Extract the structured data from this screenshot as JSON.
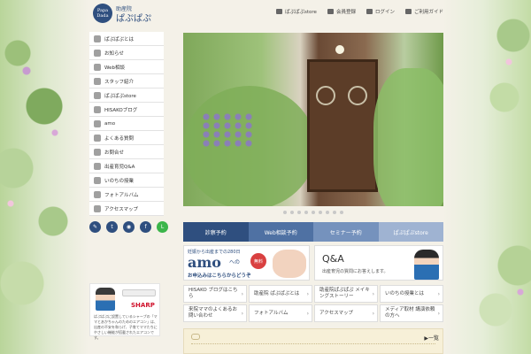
{
  "header": {
    "logo_mark": "Papa Dada",
    "logo_sub": "助産院",
    "logo_name": "ぱぷぱぷ",
    "nav": [
      {
        "label": "ぱぷぱぷstore",
        "icon": "store-icon"
      },
      {
        "label": "会員登録",
        "icon": "user-icon"
      },
      {
        "label": "ログイン",
        "icon": "login-icon"
      },
      {
        "label": "ご利用ガイド",
        "icon": "question-icon"
      }
    ]
  },
  "sidebar": {
    "items": [
      {
        "label": "ぱぷぱぷとは",
        "icon": "info-icon"
      },
      {
        "label": "お知らせ",
        "icon": "news-icon"
      },
      {
        "label": "Web相談",
        "icon": "computer-icon"
      },
      {
        "label": "スタッフ紹介",
        "icon": "staff-icon"
      },
      {
        "label": "ぱぷぱぷstore",
        "icon": "cart-icon"
      },
      {
        "label": "HISAKOブログ",
        "icon": "blog-icon"
      },
      {
        "label": "amo",
        "icon": "mail-icon"
      },
      {
        "label": "よくある質問",
        "icon": "question-icon"
      },
      {
        "label": "お問合せ",
        "icon": "chat-icon"
      },
      {
        "label": "出産育児Q&A",
        "icon": "qa-icon"
      },
      {
        "label": "いのちの授業",
        "icon": "heart-icon"
      },
      {
        "label": "フォトアルバム",
        "icon": "photo-icon"
      },
      {
        "label": "アクセスマップ",
        "icon": "map-icon"
      }
    ],
    "social": [
      {
        "label": "✎",
        "name": "blog-social-button"
      },
      {
        "label": "t",
        "name": "twitter-button"
      },
      {
        "label": "◉",
        "name": "instagram-button"
      },
      {
        "label": "f",
        "name": "facebook-button"
      },
      {
        "label": "L",
        "name": "line-button"
      }
    ],
    "sharp": {
      "logo": "SHARP",
      "text": "ぱぷぱぷに設置しているシャープの「ママとあかちゃんのためのエアコン」は、出産の不安を和らげ、子育てママたちにやさしい機能が搭載されたエアコンです。"
    }
  },
  "hero": {
    "dot_count": 9
  },
  "tabs": [
    {
      "label": "診察予約",
      "color": "#2f4f7f"
    },
    {
      "label": "Web相談予約",
      "color": "#4f71a3"
    },
    {
      "label": "セミナー予約",
      "color": "#7592bd"
    },
    {
      "label": "ぱぷぱぷstore",
      "color": "#9fb3d2"
    }
  ],
  "banners": {
    "amo": {
      "top": "妊娠から出産までの280日",
      "big": "amo",
      "no": "への",
      "free": "無料",
      "cta": "お申込みはこちらからどうぞ"
    },
    "qa": {
      "title": "Q&A",
      "sub": "出産育児の質問にお答えします。"
    }
  },
  "grid": [
    "HISAKO ブログはこちら",
    "助産院 ぱぷぱぷとは",
    "助産院ぱぷぱぷ メイキングストーリー",
    "いのちの授業とは",
    "来院ママのよくあるお問い合わせ",
    "フォトアルバム",
    "アクセスマップ",
    "メディア取材 講演依頼の方へ"
  ],
  "bottom": {
    "link": "一覧"
  }
}
